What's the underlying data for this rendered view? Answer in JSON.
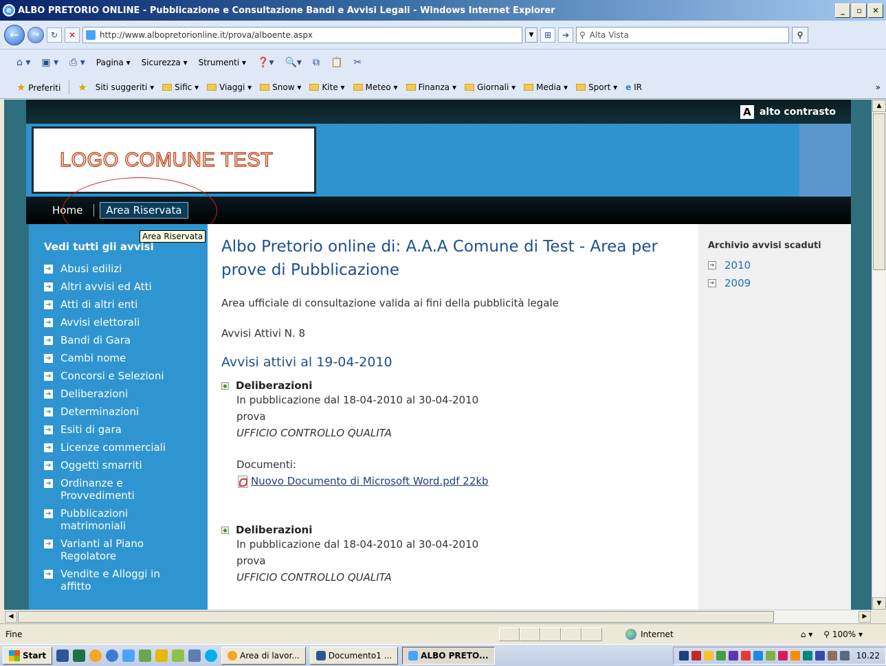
{
  "window": {
    "title": "ALBO PRETORIO ONLINE - Pubblicazione e Consultazione Bandi e Avvisi Legali - Windows Internet Explorer"
  },
  "address": {
    "url": "http://www.albopretorionline.it/prova/alboente.aspx",
    "search_placeholder": "Alta Vista"
  },
  "command_bar": {
    "items": [
      "Pagina",
      "Sicurezza",
      "Strumenti"
    ]
  },
  "favorites_bar": {
    "favorites_label": "Preferiti",
    "links": [
      "Siti suggeriti",
      "Sific",
      "Viaggi",
      "Snow",
      "Kite",
      "Meteo",
      "Finanza",
      "Giornali",
      "Media",
      "Sport",
      "IR"
    ]
  },
  "site": {
    "contrast_label": "alto contrasto",
    "logo_text": "LOGO COMUNE TEST",
    "menu": {
      "home": "Home",
      "reserved": "Area Riservata"
    },
    "tooltip": "Area Riservata",
    "left": {
      "title": "Vedi tutti gli avvisi",
      "items": [
        "Abusi edilizi",
        "Altri avvisi ed Atti",
        "Atti di altri enti",
        "Avvisi elettorali",
        "Bandi di Gara",
        "Cambi nome",
        "Concorsi e Selezioni",
        "Deliberazioni",
        "Determinazioni",
        "Esiti di gara",
        "Licenze commerciali",
        "Oggetti smarriti",
        "Ordinanze e Provvedimenti",
        "Pubblicazioni matrimoniali",
        "Varianti al Piano Regolatore",
        "Vendite e Alloggi in affitto"
      ]
    },
    "main": {
      "title": "Albo Pretorio online di: A.A.A Comune di Test - Area per prove di Pubblicazione",
      "subtitle": "Area ufficiale di consultazione valida ai fini della pubblicità legale",
      "count": "Avvisi Attivi N. 8",
      "heading": "Avvisi attivi al 19-04-2010",
      "entries": [
        {
          "title": "Deliberazioni",
          "period": "In pubblicazione dal 18-04-2010 al 30-04-2010",
          "desc": "prova",
          "office": "UFFICIO CONTROLLO QUALITA",
          "docs_label": "Documenti:",
          "doc_link": "Nuovo Documento di Microsoft Word.pdf 22kb"
        },
        {
          "title": "Deliberazioni",
          "period": "In pubblicazione dal 18-04-2010 al 30-04-2010",
          "desc": "prova",
          "office": "UFFICIO CONTROLLO QUALITA"
        }
      ]
    },
    "right": {
      "title": "Archivio avvisi scaduti",
      "items": [
        "2010",
        "2009"
      ]
    }
  },
  "status": {
    "text": "Fine",
    "zone": "Internet",
    "zoom": "100%"
  },
  "taskbar": {
    "start": "Start",
    "tasks": [
      "Area di lavor...",
      "Documento1 ...",
      "ALBO PRETO..."
    ],
    "clock": "10.22"
  }
}
